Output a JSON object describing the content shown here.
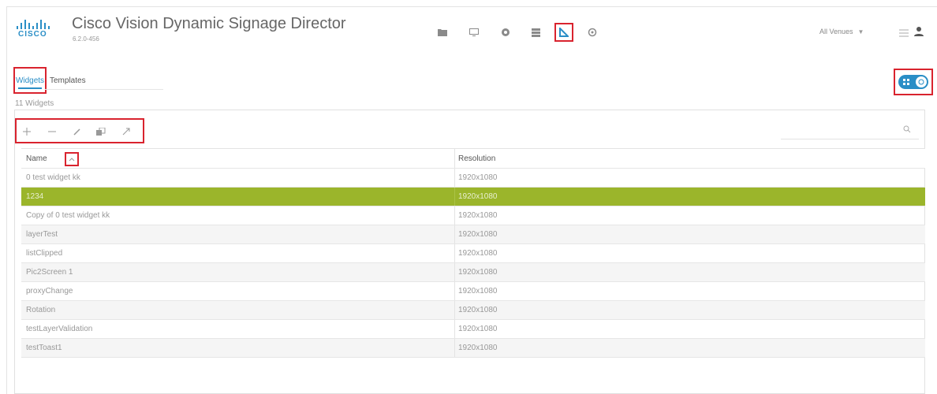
{
  "header": {
    "logo_text": "CISCO",
    "title": "Cisco Vision Dynamic Signage Director",
    "version": "6.2.0-456",
    "nav_icons": [
      "folder-icon",
      "monitor-icon",
      "gear-icon",
      "grid-icon",
      "designer-icon",
      "settings-icon"
    ],
    "active_nav": "designer-icon",
    "venue_selector": "All Venues",
    "accent_color": "#2a8ec6",
    "highlight_color": "#d9232e"
  },
  "tabs": [
    {
      "label": "Widgets",
      "active": true
    },
    {
      "label": "Templates",
      "active": false
    }
  ],
  "widget_count": "11 Widgets",
  "toolbar": {
    "buttons": [
      "add-icon",
      "remove-icon",
      "edit-icon",
      "copy-icon",
      "resize-icon"
    ]
  },
  "search": {
    "placeholder": ""
  },
  "table": {
    "columns": [
      "Name",
      "Resolution"
    ],
    "sort_column": "Name",
    "rows": [
      {
        "name": "0 test widget kk",
        "resolution": "1920x1080"
      },
      {
        "name": "1234",
        "resolution": "1920x1080",
        "selected": true
      },
      {
        "name": "Copy of 0 test widget kk",
        "resolution": "1920x1080"
      },
      {
        "name": "layerTest",
        "resolution": "1920x1080"
      },
      {
        "name": "listClipped",
        "resolution": "1920x1080"
      },
      {
        "name": "Pic2Screen 1",
        "resolution": "1920x1080"
      },
      {
        "name": "proxyChange",
        "resolution": "1920x1080"
      },
      {
        "name": "Rotation",
        "resolution": "1920x1080"
      },
      {
        "name": "testLayerValidation",
        "resolution": "1920x1080"
      },
      {
        "name": "testToast1",
        "resolution": "1920x1080"
      }
    ],
    "selected_color": "#9bb52b"
  }
}
